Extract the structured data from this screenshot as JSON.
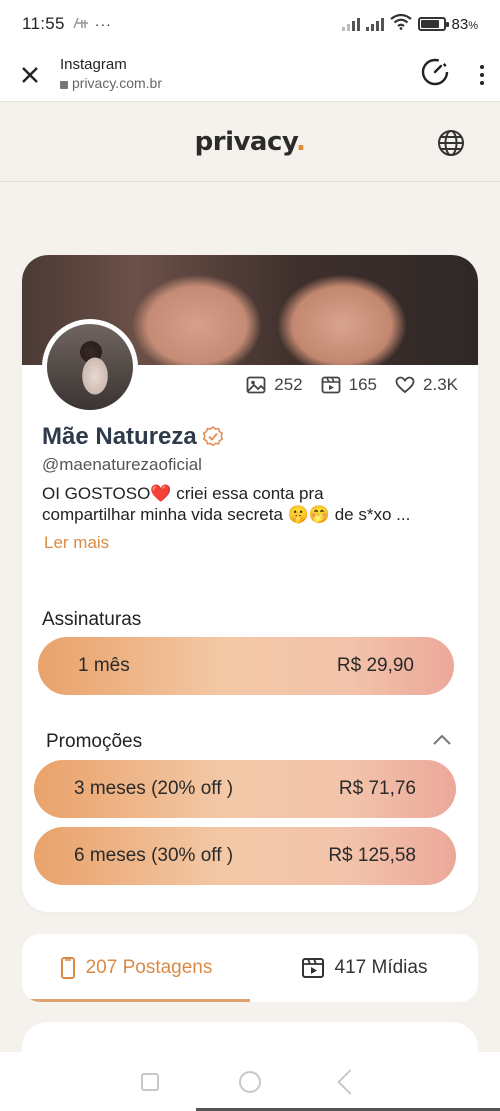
{
  "status_bar": {
    "time": "11:55",
    "notif_dots": "···",
    "battery_pct": "83",
    "battery_pct_suffix": "%",
    "battery_level": 0.83
  },
  "browser": {
    "title": "Instagram",
    "url": "privacy.com.br",
    "close_icon": "close-icon",
    "timer_icon": "timer-icon",
    "menu_icon": "more-vertical-icon"
  },
  "site": {
    "logo_text": "privacy",
    "logo_dot": ".",
    "globe_icon": "globe-icon",
    "accent_color": "#e08a3a"
  },
  "profile": {
    "name": "Mãe Natureza",
    "handle": "@maenaturezaoficial",
    "bio_line1_a": "OI GOSTOSO",
    "bio_heart": "❤️",
    "bio_line1_b": " criei essa conta pra",
    "bio_line2": "compartilhar minha vida secreta 🤫🤭 de s*xo ...",
    "read_more": "Ler mais",
    "stats": {
      "photos": "252",
      "videos": "165",
      "likes": "2.3K"
    }
  },
  "subscriptions": {
    "title": "Assinaturas",
    "plans": [
      {
        "label": "1 mês",
        "price": "R$ 29,90"
      }
    ]
  },
  "promotions": {
    "title": "Promoções",
    "plans": [
      {
        "label": "3 meses (20% off )",
        "price": "R$ 71,76"
      },
      {
        "label": "6 meses (30% off )",
        "price": "R$ 125,58"
      }
    ]
  },
  "tabs": [
    {
      "label": "207 Postagens",
      "icon": "phone-post-icon"
    },
    {
      "label": "417 Mídias",
      "icon": "video-media-icon"
    }
  ]
}
